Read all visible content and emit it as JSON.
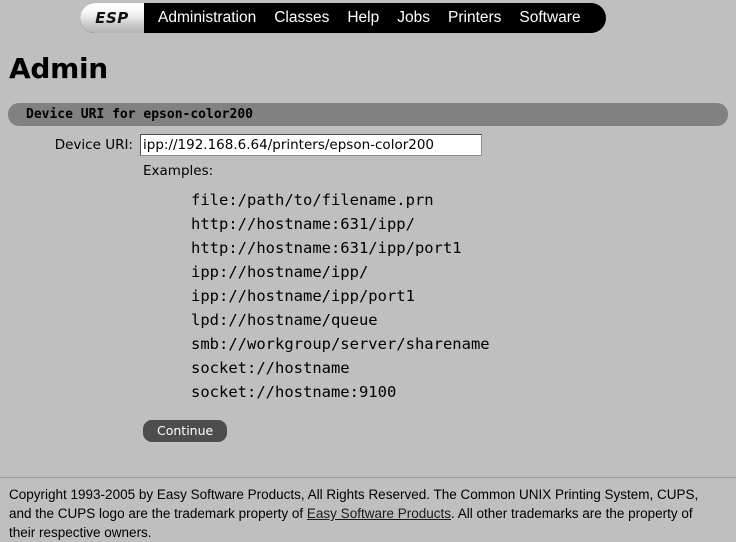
{
  "nav": {
    "logo": "ESP",
    "items": [
      {
        "label": "Administration",
        "name": "nav-item-administration"
      },
      {
        "label": "Classes",
        "name": "nav-item-classes"
      },
      {
        "label": "Help",
        "name": "nav-item-help"
      },
      {
        "label": "Jobs",
        "name": "nav-item-jobs"
      },
      {
        "label": "Printers",
        "name": "nav-item-printers"
      },
      {
        "label": "Software",
        "name": "nav-item-software"
      }
    ]
  },
  "page": {
    "title": "Admin"
  },
  "section": {
    "header": "Device URI for epson-color200"
  },
  "form": {
    "uri_label": "Device URI:",
    "uri_value": "ipp://192.168.6.64/printers/epson-color200",
    "uri_placeholder": "",
    "examples_label": "Examples:",
    "examples": [
      "file:/path/to/filename.prn",
      "http://hostname:631/ipp/",
      "http://hostname:631/ipp/port1",
      "ipp://hostname/ipp/",
      "ipp://hostname/ipp/port1",
      "lpd://hostname/queue",
      "smb://workgroup/server/sharename",
      "socket://hostname",
      "socket://hostname:9100"
    ],
    "continue_label": "Continue"
  },
  "footer": {
    "text_before_link": "Copyright 1993-2005 by Easy Software Products, All Rights Reserved. The Common UNIX Printing System, CUPS, and the CUPS logo are the trademark property of ",
    "link_label": "Easy Software Products",
    "text_after_link": ". All other trademarks are the property of their respective owners."
  },
  "colors": {
    "page_background": "#bfbfbf",
    "nav_background": "#000000",
    "section_bar": "#818181",
    "button_background": "#4d4d4d",
    "input_background": "#ffffff"
  }
}
